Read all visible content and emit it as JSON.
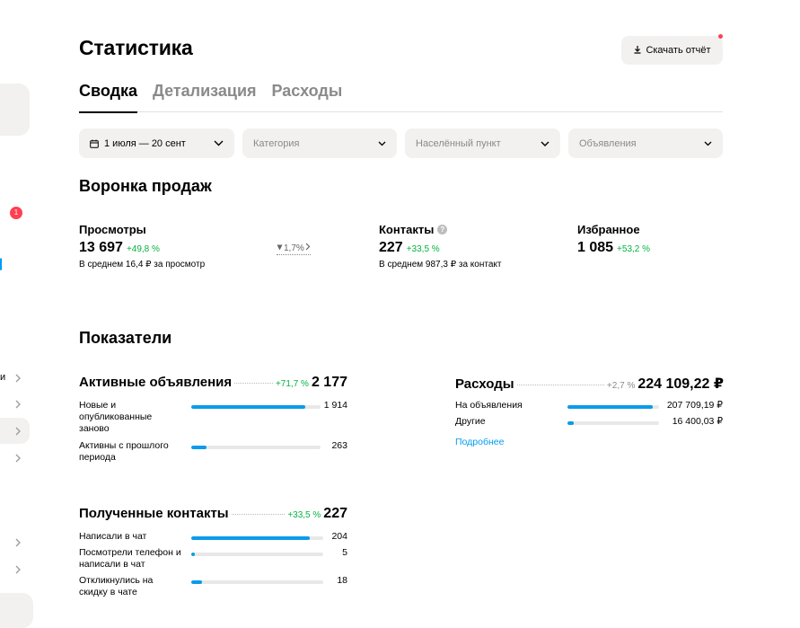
{
  "sidebar": {
    "badge": "1",
    "fragments": [
      "и"
    ]
  },
  "header": {
    "title": "Статистика",
    "report_button": "Скачать отчёт"
  },
  "tabs": [
    {
      "label": "Сводка",
      "active": true
    },
    {
      "label": "Детализация",
      "active": false
    },
    {
      "label": "Расходы",
      "active": false
    }
  ],
  "filters": {
    "date": "1 июля — 20 сент",
    "category": "Категория",
    "locality": "Населённый пункт",
    "ads": "Объявления"
  },
  "funnel": {
    "title": "Воронка продаж",
    "views": {
      "label": "Просмотры",
      "value": "13 697",
      "delta": "+49,8 %",
      "sub": "В среднем 16,4 ₽ за просмотр"
    },
    "conversion": "1,7%",
    "contacts": {
      "label": "Контакты",
      "value": "227",
      "delta": "+33,5 %",
      "sub": "В среднем 987,3 ₽ за контакт",
      "help": "?"
    },
    "favorites": {
      "label": "Избранное",
      "value": "1 085",
      "delta": "+53,2 %"
    }
  },
  "indicators": {
    "title": "Показатели",
    "active_ads": {
      "title": "Активные объявления",
      "delta": "+71,7 %",
      "total": "2 177",
      "rows": [
        {
          "label": "Новые и опубликованные заново",
          "value": "1 914",
          "fill": 0.88
        },
        {
          "label": "Активны с прошлого периода",
          "value": "263",
          "fill": 0.12
        }
      ]
    },
    "expenses": {
      "title": "Расходы",
      "delta": "+2,7 %",
      "total": "224 109,22 ₽",
      "rows": [
        {
          "label": "На объявления",
          "value": "207 709,19 ₽",
          "fill": 0.93
        },
        {
          "label": "Другие",
          "value": "16 400,03 ₽",
          "fill": 0.07
        }
      ],
      "link": "Подробнее"
    },
    "contacts": {
      "title": "Полученные контакты",
      "delta": "+33,5 %",
      "total": "227",
      "rows": [
        {
          "label": "Написали в чат",
          "value": "204",
          "fill": 0.9
        },
        {
          "label": "Посмотрели телефон и написали в чат",
          "value": "5",
          "fill": 0.02
        },
        {
          "label": "Откликнулись на скидку в чате",
          "value": "18",
          "fill": 0.08
        }
      ]
    }
  },
  "colors": {
    "accent": "#0a9bea",
    "positive": "#04b340",
    "badge": "#ff4053",
    "surface": "#f2f1f0"
  }
}
